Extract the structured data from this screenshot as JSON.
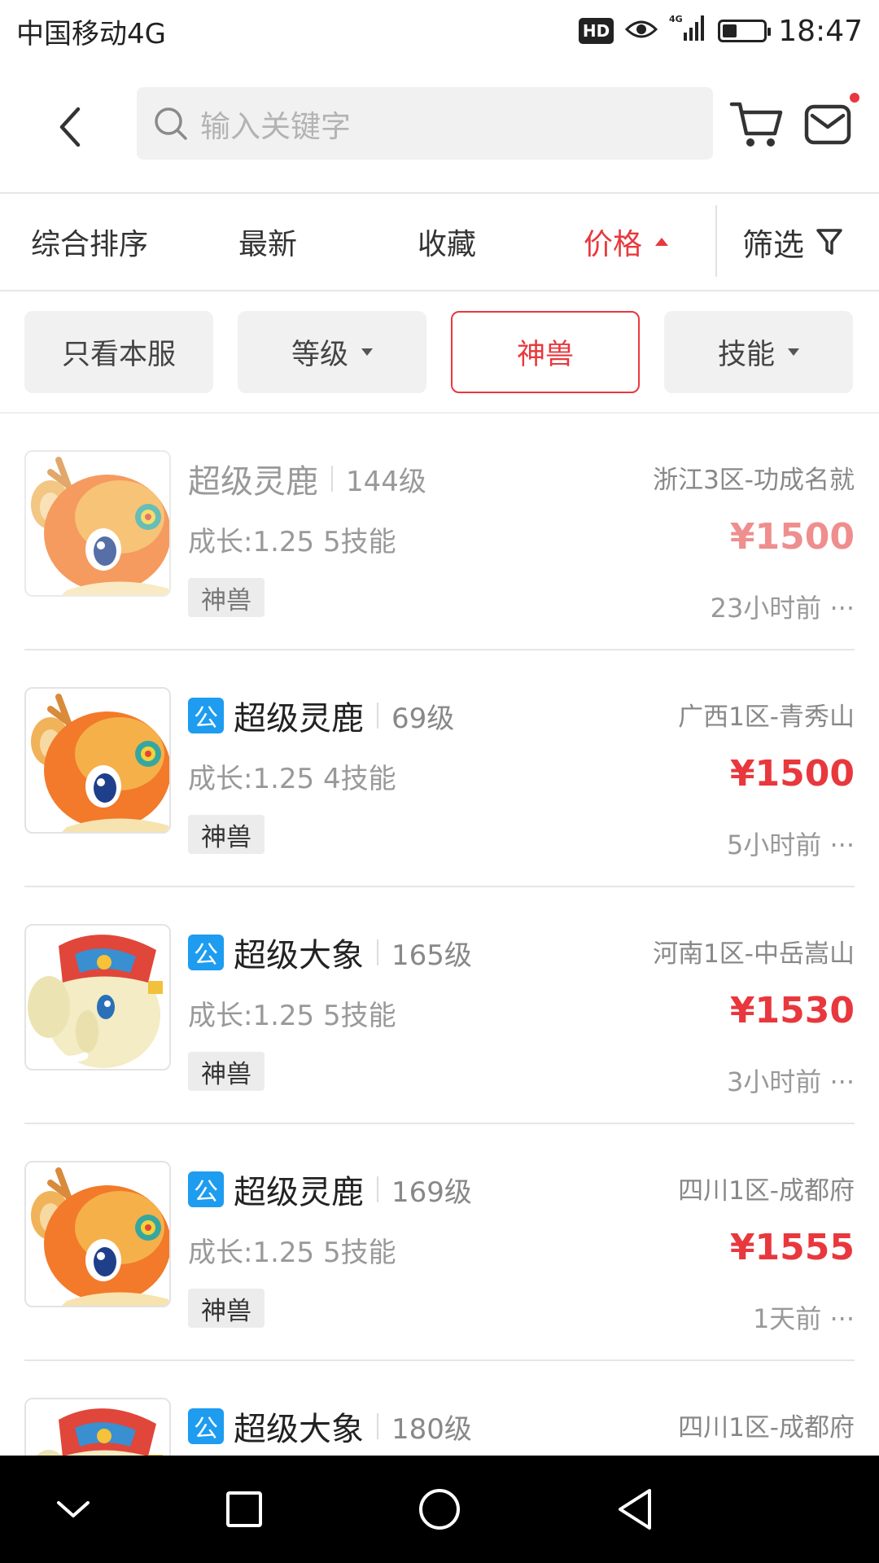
{
  "status_bar": {
    "carrier": "中国移动4G",
    "hd": "HD",
    "time": "18:47",
    "battery_level": 0.35
  },
  "header": {
    "search_placeholder": "输入关键字",
    "has_notification_dot": true
  },
  "sort_bar": {
    "items": [
      {
        "label": "综合排序",
        "active": false
      },
      {
        "label": "最新",
        "active": false
      },
      {
        "label": "收藏",
        "active": false
      },
      {
        "label": "价格",
        "active": true
      }
    ],
    "filter_label": "筛选"
  },
  "chips": [
    {
      "label": "只看本服",
      "selected": false
    },
    {
      "label": "等级",
      "selected": false
    },
    {
      "label": "神兽",
      "selected": true
    },
    {
      "label": "技能",
      "selected": false
    }
  ],
  "colors": {
    "accent": "#e8383d",
    "official_badge": "#1d9cf0"
  },
  "listings": [
    {
      "official": false,
      "badge": "",
      "name": "超级灵鹿",
      "level": "144级",
      "server": "浙江3区-功成名就",
      "growth": "成长:1.25 5技能",
      "price": "¥1500",
      "tag": "神兽",
      "time": "23小时前 ···",
      "pet": "deer"
    },
    {
      "official": true,
      "badge": "公",
      "name": "超级灵鹿",
      "level": "69级",
      "server": "广西1区-青秀山",
      "growth": "成长:1.25 4技能",
      "price": "¥1500",
      "tag": "神兽",
      "time": "5小时前 ···",
      "pet": "deer"
    },
    {
      "official": true,
      "badge": "公",
      "name": "超级大象",
      "level": "165级",
      "server": "河南1区-中岳嵩山",
      "growth": "成长:1.25 5技能",
      "price": "¥1530",
      "tag": "神兽",
      "time": "3小时前 ···",
      "pet": "elephant"
    },
    {
      "official": true,
      "badge": "公",
      "name": "超级灵鹿",
      "level": "169级",
      "server": "四川1区-成都府",
      "growth": "成长:1.25 5技能",
      "price": "¥1555",
      "tag": "神兽",
      "time": "1天前 ···",
      "pet": "deer"
    },
    {
      "official": true,
      "badge": "公",
      "name": "超级大象",
      "level": "180级",
      "server": "四川1区-成都府",
      "pet": "elephant"
    }
  ]
}
